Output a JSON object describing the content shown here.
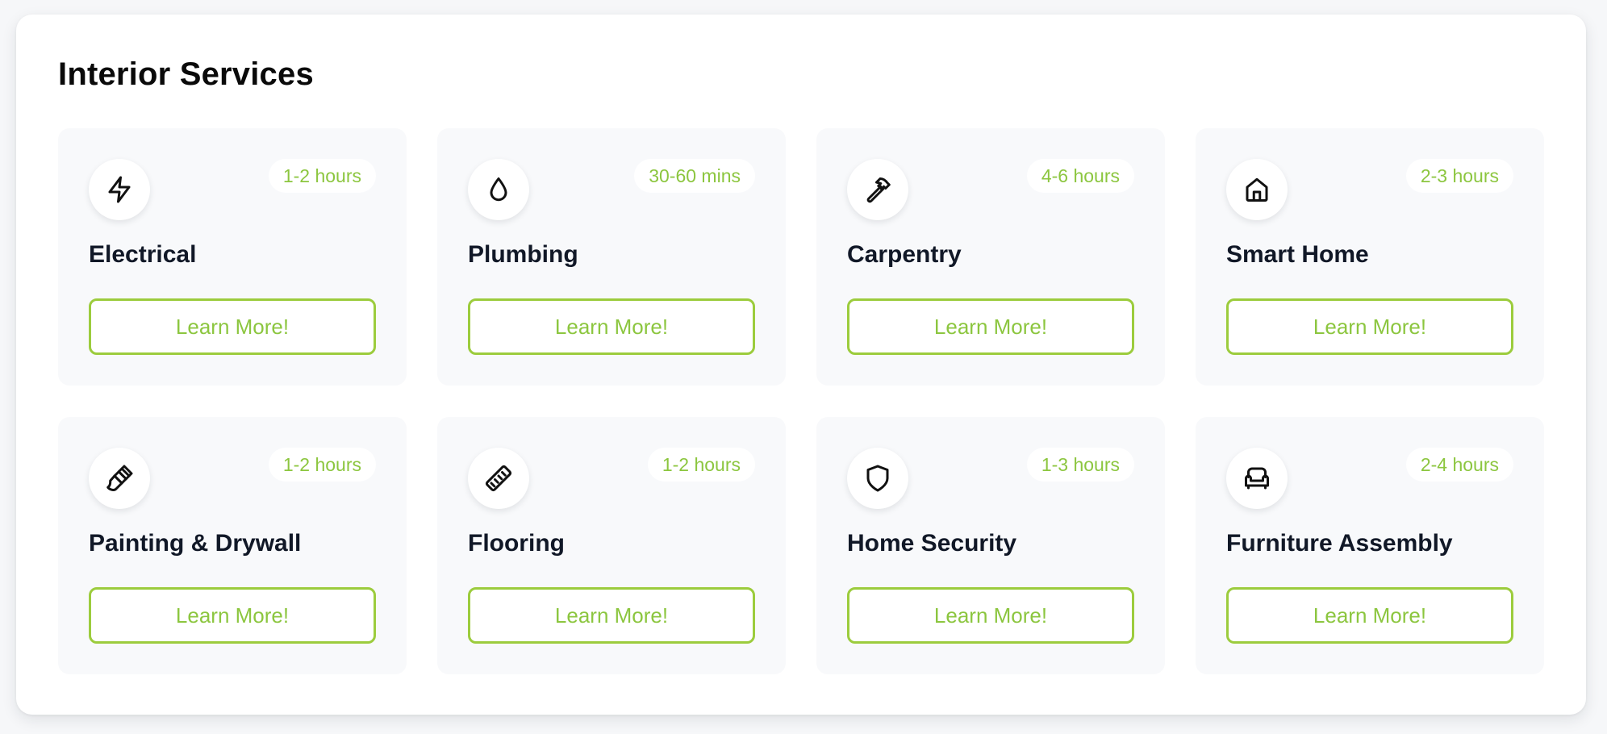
{
  "section_title": "Interior Services",
  "accent_color": "#8cc63f",
  "services": [
    {
      "name": "Electrical",
      "duration": "1-2 hours",
      "icon": "lightning-icon",
      "button_label": "Learn More!"
    },
    {
      "name": "Plumbing",
      "duration": "30-60 mins",
      "icon": "droplet-icon",
      "button_label": "Learn More!"
    },
    {
      "name": "Carpentry",
      "duration": "4-6 hours",
      "icon": "hammer-icon",
      "button_label": "Learn More!"
    },
    {
      "name": "Smart Home",
      "duration": "2-3 hours",
      "icon": "home-icon",
      "button_label": "Learn More!"
    },
    {
      "name": "Painting & Drywall",
      "duration": "1-2 hours",
      "icon": "paintbrush-icon",
      "button_label": "Learn More!"
    },
    {
      "name": "Flooring",
      "duration": "1-2 hours",
      "icon": "ruler-icon",
      "button_label": "Learn More!"
    },
    {
      "name": "Home Security",
      "duration": "1-3 hours",
      "icon": "shield-icon",
      "button_label": "Learn More!"
    },
    {
      "name": "Furniture Assembly",
      "duration": "2-4 hours",
      "icon": "sofa-icon",
      "button_label": "Learn More!"
    }
  ]
}
